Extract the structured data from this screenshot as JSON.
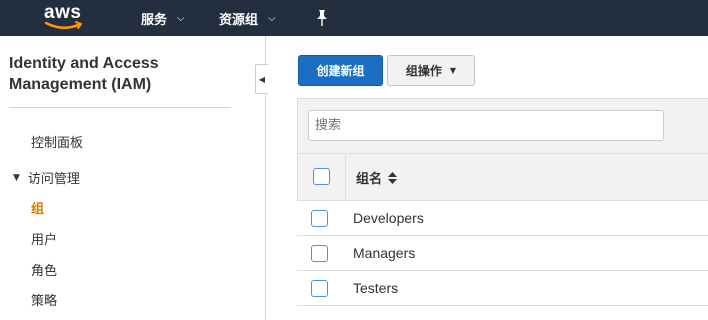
{
  "topnav": {
    "logo_text": "aws",
    "services_label": "服务",
    "resource_groups_label": "资源组"
  },
  "sidebar": {
    "title": "Identity and Access Management (IAM)",
    "dashboard_label": "控制面板",
    "section_label": "访问管理",
    "items": [
      {
        "label": "组",
        "active": true
      },
      {
        "label": "用户",
        "active": false
      },
      {
        "label": "角色",
        "active": false
      },
      {
        "label": "策略",
        "active": false
      }
    ]
  },
  "toolbar": {
    "create_label": "创建新组",
    "actions_label": "组操作"
  },
  "search": {
    "placeholder": "搜索"
  },
  "table": {
    "column_header": "组名",
    "rows": [
      "Developers",
      "Managers",
      "Testers"
    ]
  },
  "colors": {
    "nav_bg": "#232f3e",
    "primary_button": "#1a6fc4",
    "active_link": "#e07b00"
  }
}
